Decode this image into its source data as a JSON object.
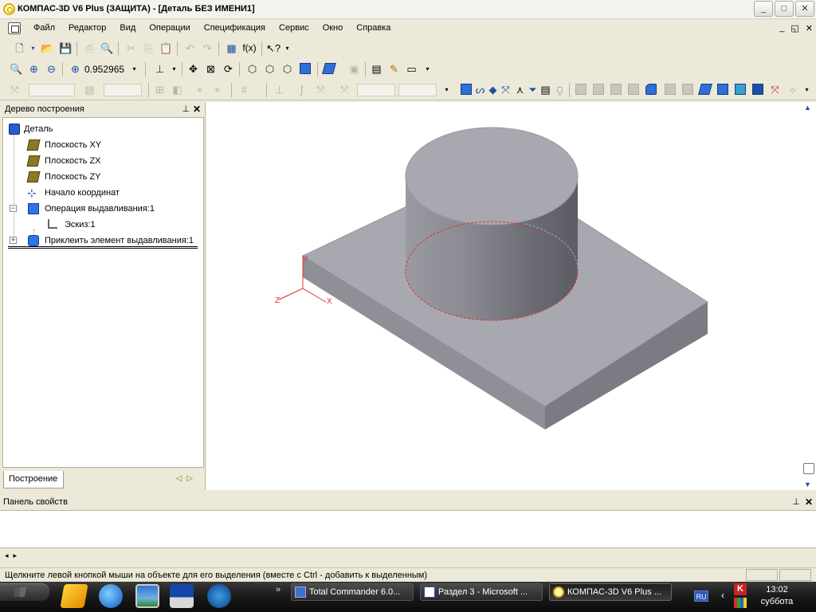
{
  "window": {
    "title": "КОМПАС-3D V6 Plus (ЗАЩИТА) - [Деталь БЕЗ ИМЕНИ1]",
    "controls": [
      "_",
      "□",
      "✕"
    ]
  },
  "menu": {
    "items": [
      "Файл",
      "Редактор",
      "Вид",
      "Операции",
      "Спецификация",
      "Сервис",
      "Окно",
      "Справка"
    ],
    "mdi_controls": [
      "_",
      "◱",
      "✕"
    ]
  },
  "toolbar": {
    "zoom_value": "0.952965",
    "fx_label": "f(x)"
  },
  "tree_panel": {
    "title": "Дерево построения",
    "pin": "ᅟ",
    "close": "✕",
    "nodes": [
      {
        "label": "Деталь",
        "icon": "part-icon"
      },
      {
        "label": "Плоскость XY",
        "icon": "plane-icon"
      },
      {
        "label": "Плоскость ZX",
        "icon": "plane-icon"
      },
      {
        "label": "Плоскость ZY",
        "icon": "plane-icon"
      },
      {
        "label": "Начало координат",
        "icon": "origin-icon"
      },
      {
        "label": "Операция выдавливания:1",
        "icon": "extrude-icon",
        "expander": "−"
      },
      {
        "label": "Эскиз:1",
        "icon": "sketch-icon"
      },
      {
        "label": "Приклеить элемент выдавливания:1",
        "icon": "boss-extrude-icon",
        "expander": "+"
      }
    ],
    "tab_label": "Построение"
  },
  "viewport": {
    "axis_labels": {
      "z": "Z",
      "x": "X",
      "y": "Y"
    },
    "colors": {
      "top": "#a5a5ad",
      "side_left": "#8e8e96",
      "side_front": "#7c7c84",
      "sketch": "#e03030"
    }
  },
  "properties_panel": {
    "title": "Панель свойств"
  },
  "status": {
    "text": "Щелкните левой кнопкой мыши на объекте для его выделения (вместе с Ctrl - добавить к выделенным)"
  },
  "taskbar": {
    "tasks": [
      {
        "label": "Total Commander 6.0...",
        "icon": "floppy-icon"
      },
      {
        "label": "Раздел 3 - Microsoft ...",
        "icon": "word-icon"
      },
      {
        "label": "КОМПАС-3D V6 Plus ...",
        "icon": "kompas-icon"
      }
    ],
    "lang": "RU",
    "time": "13:02",
    "day": "суббота"
  }
}
